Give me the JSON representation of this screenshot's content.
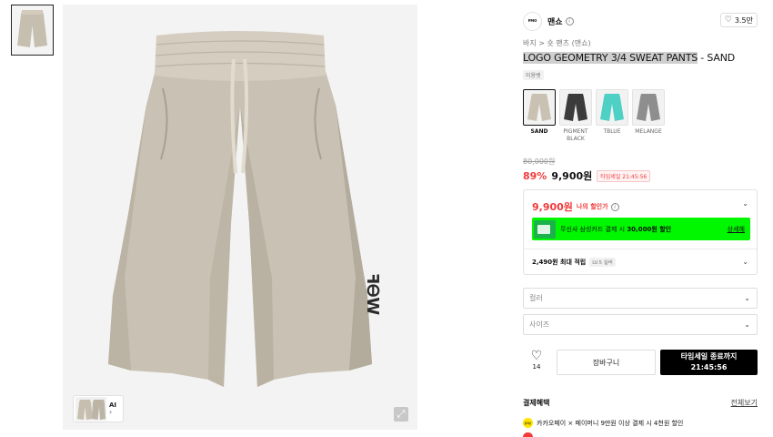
{
  "thumbnails": [
    {
      "alt": "product thumbnail"
    }
  ],
  "main_image": {
    "print_text": "ꟻᎾW",
    "ai_label": "AI",
    "ai_chevron": "›",
    "expand_icon": "⤢"
  },
  "brand": {
    "logo_text": "ᴘᴍᴏ",
    "name": "맨쇼",
    "info": "i",
    "likes": "3.5만",
    "heart": "♡"
  },
  "breadcrumb": "바지 > 숏 팬츠 (맨쇼)",
  "product": {
    "title_highlight": "LOGO GEOMETRY 3/4 SWEAT PANTS",
    "title_rest": " - SAND",
    "tag": "미용벳"
  },
  "colors": [
    {
      "label": "SAND",
      "hex": "#c9c1b2",
      "selected": true
    },
    {
      "label": "PIGMENT BLACK",
      "hex": "#3b3b3b",
      "selected": false
    },
    {
      "label": "TBLUE",
      "hex": "#4fd0c4",
      "selected": false
    },
    {
      "label": "MELANGE",
      "hex": "#8e8e8e",
      "selected": false
    }
  ],
  "pricing": {
    "original": "80,000원",
    "discount": "89%",
    "price": "9,900원",
    "timesale": "타임세일 21:45:56"
  },
  "benefits": {
    "my_price": "9,900원",
    "my_price_label": "나의 할인가",
    "card_text_prefix": "무신사 삼성카드 결제 시 ",
    "card_text_bold": "30,000원 할인",
    "card_link": "상세혜",
    "points": "2,490원 최대 적립",
    "level": "LV.5 실버",
    "chevron": "⌄"
  },
  "options": {
    "color_placeholder": "컬러",
    "size_placeholder": "사이즈"
  },
  "actions": {
    "wish_count": "14",
    "heart": "♡",
    "cart": "장바구니",
    "buy_line1": "타임세일 종료까지",
    "buy_line2": "21:45:56"
  },
  "payment": {
    "title": "결제혜택",
    "link": "전체보기",
    "kakao_text": "카카오페이 × 페이머니 9만원 이상 결제 시 4천원 할인",
    "kakao_icon": "pay"
  }
}
